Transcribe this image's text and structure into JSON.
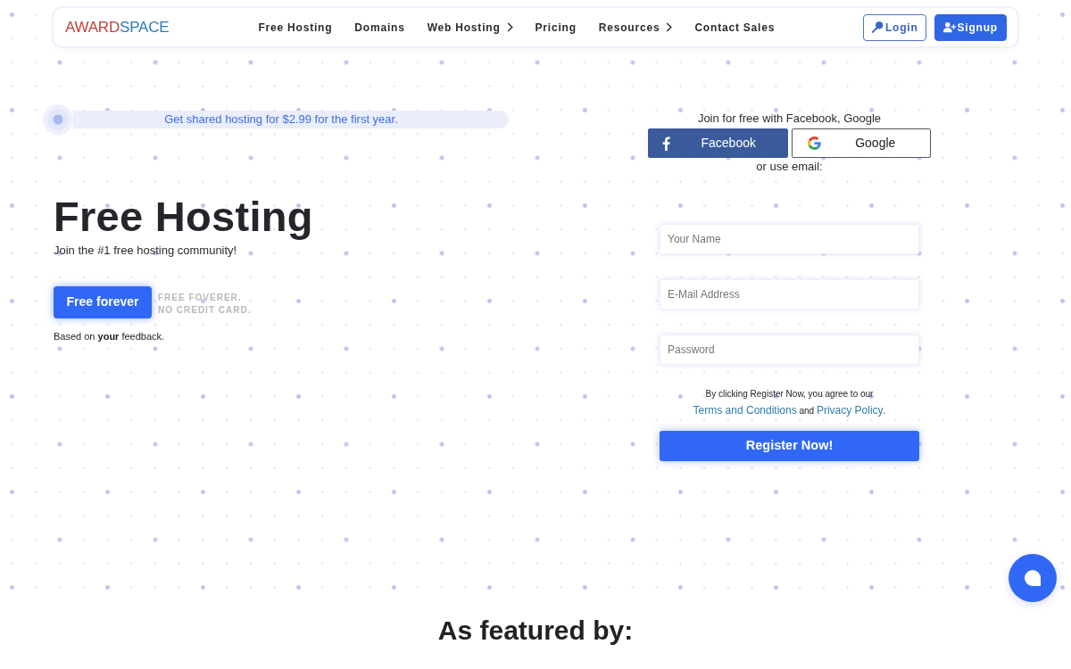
{
  "navbar": {
    "logo": {
      "first": "AWARD",
      "second": "SPACE"
    },
    "links": [
      {
        "label": "Free Hosting",
        "has_submenu": false
      },
      {
        "label": "Domains",
        "has_submenu": false
      },
      {
        "label": "Web Hosting",
        "has_submenu": true
      },
      {
        "label": "Pricing",
        "has_submenu": false
      },
      {
        "label": "Resources",
        "has_submenu": true
      },
      {
        "label": "Contact Sales",
        "has_submenu": false
      }
    ],
    "buttons": [
      {
        "label": "Login",
        "kind": "outline"
      },
      {
        "label": "Signup",
        "kind": "filled"
      }
    ]
  },
  "promo": {
    "text": "Get shared hosting for $2.99 for the first year."
  },
  "hero": {
    "title": "Free Hosting",
    "subtitle": "Join the #1 free hosting community!",
    "cta": "Free forever",
    "note_lines": [
      "FREE FOVERER.",
      "NO CREDIT CARD."
    ],
    "feedback": "Based on **your** feedback."
  },
  "signup": {
    "intro": "Join for free with Facebook, Google",
    "social_buttons": [
      {
        "label": "Facebook",
        "kind": "facebook"
      },
      {
        "label": "Google",
        "kind": "google"
      }
    ],
    "divider": "or use email:",
    "fields": [
      {
        "placeholder": "Your Name"
      },
      {
        "placeholder": "E-Mail Address"
      },
      {
        "placeholder": "Password"
      }
    ],
    "consent": {
      "lead": "By clicking Register Now, you agree to our",
      "terms_link": "Terms and Conditions",
      "joiner": "and",
      "privacy_link": "Privacy Policy",
      "end": "."
    },
    "submit": "Register Now!"
  },
  "featured": {
    "heading": "As featured by:"
  }
}
